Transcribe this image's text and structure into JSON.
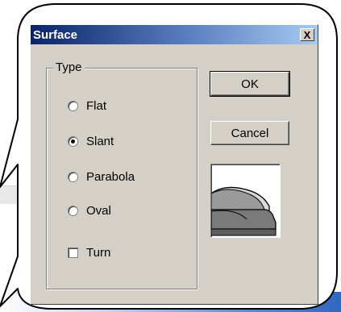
{
  "dialog": {
    "title": "Surface",
    "close_label": "X"
  },
  "type_group": {
    "label": "Type",
    "options": [
      {
        "label": "Flat",
        "checked": false
      },
      {
        "label": "Slant",
        "checked": true
      },
      {
        "label": "Parabola",
        "checked": false
      },
      {
        "label": "Oval",
        "checked": false
      }
    ],
    "turn": {
      "label": "Turn",
      "checked": false
    }
  },
  "buttons": {
    "ok_label": "OK",
    "cancel_label": "Cancel"
  },
  "preview": {
    "icon": "slant-surface-preview-icon"
  },
  "colors": {
    "dialog_bg": "#d4d0c8",
    "titlebar_start": "#0a246a",
    "titlebar_end": "#a6caf0"
  }
}
